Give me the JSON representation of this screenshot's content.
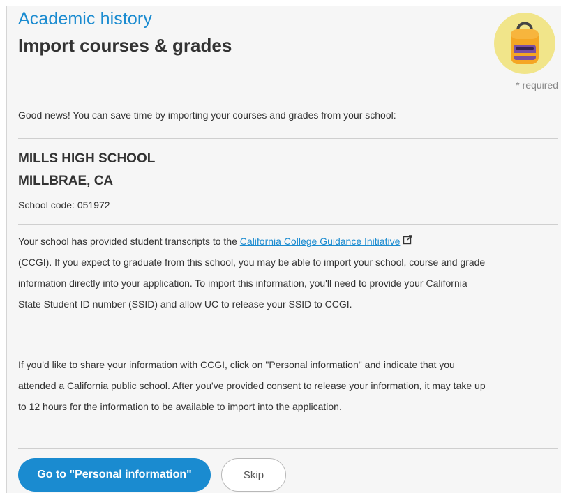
{
  "header": {
    "section_title": "Academic history",
    "page_title": "Import courses & grades",
    "required_note": "* required"
  },
  "intro": {
    "text": "Good news! You can save time by importing your courses and grades from your school:"
  },
  "school": {
    "name": "MILLS HIGH SCHOOL",
    "city": "MILLBRAE, CA",
    "code_label": "School code: 051972"
  },
  "info": {
    "para1_before_link": "Your school has provided student transcripts to the ",
    "link_text": "California College Guidance Initiative",
    "para1_after_link": "(CCGI). If you expect to graduate from this school, you may be able to import your school, course and grade information directly into your application. To import this information, you'll need to provide your California State Student ID number (SSID) and allow UC to release your SSID to CCGI.",
    "para2": "If you'd like to share your information with CCGI, click on \"Personal information\" and indicate that you attended a California public school. After you've provided consent to release your information, it may take up to 12 hours for the information to be available to import into the application."
  },
  "actions": {
    "primary_label": "Go to \"Personal information\"",
    "secondary_label": "Skip"
  },
  "icons": {
    "avatar": "backpack-icon",
    "external_link": "external-link-icon"
  },
  "colors": {
    "accent": "#1a8bd0",
    "avatar_bg": "#f1e58a",
    "backpack_body": "#f5a623",
    "backpack_pocket": "#7b4fa3"
  }
}
